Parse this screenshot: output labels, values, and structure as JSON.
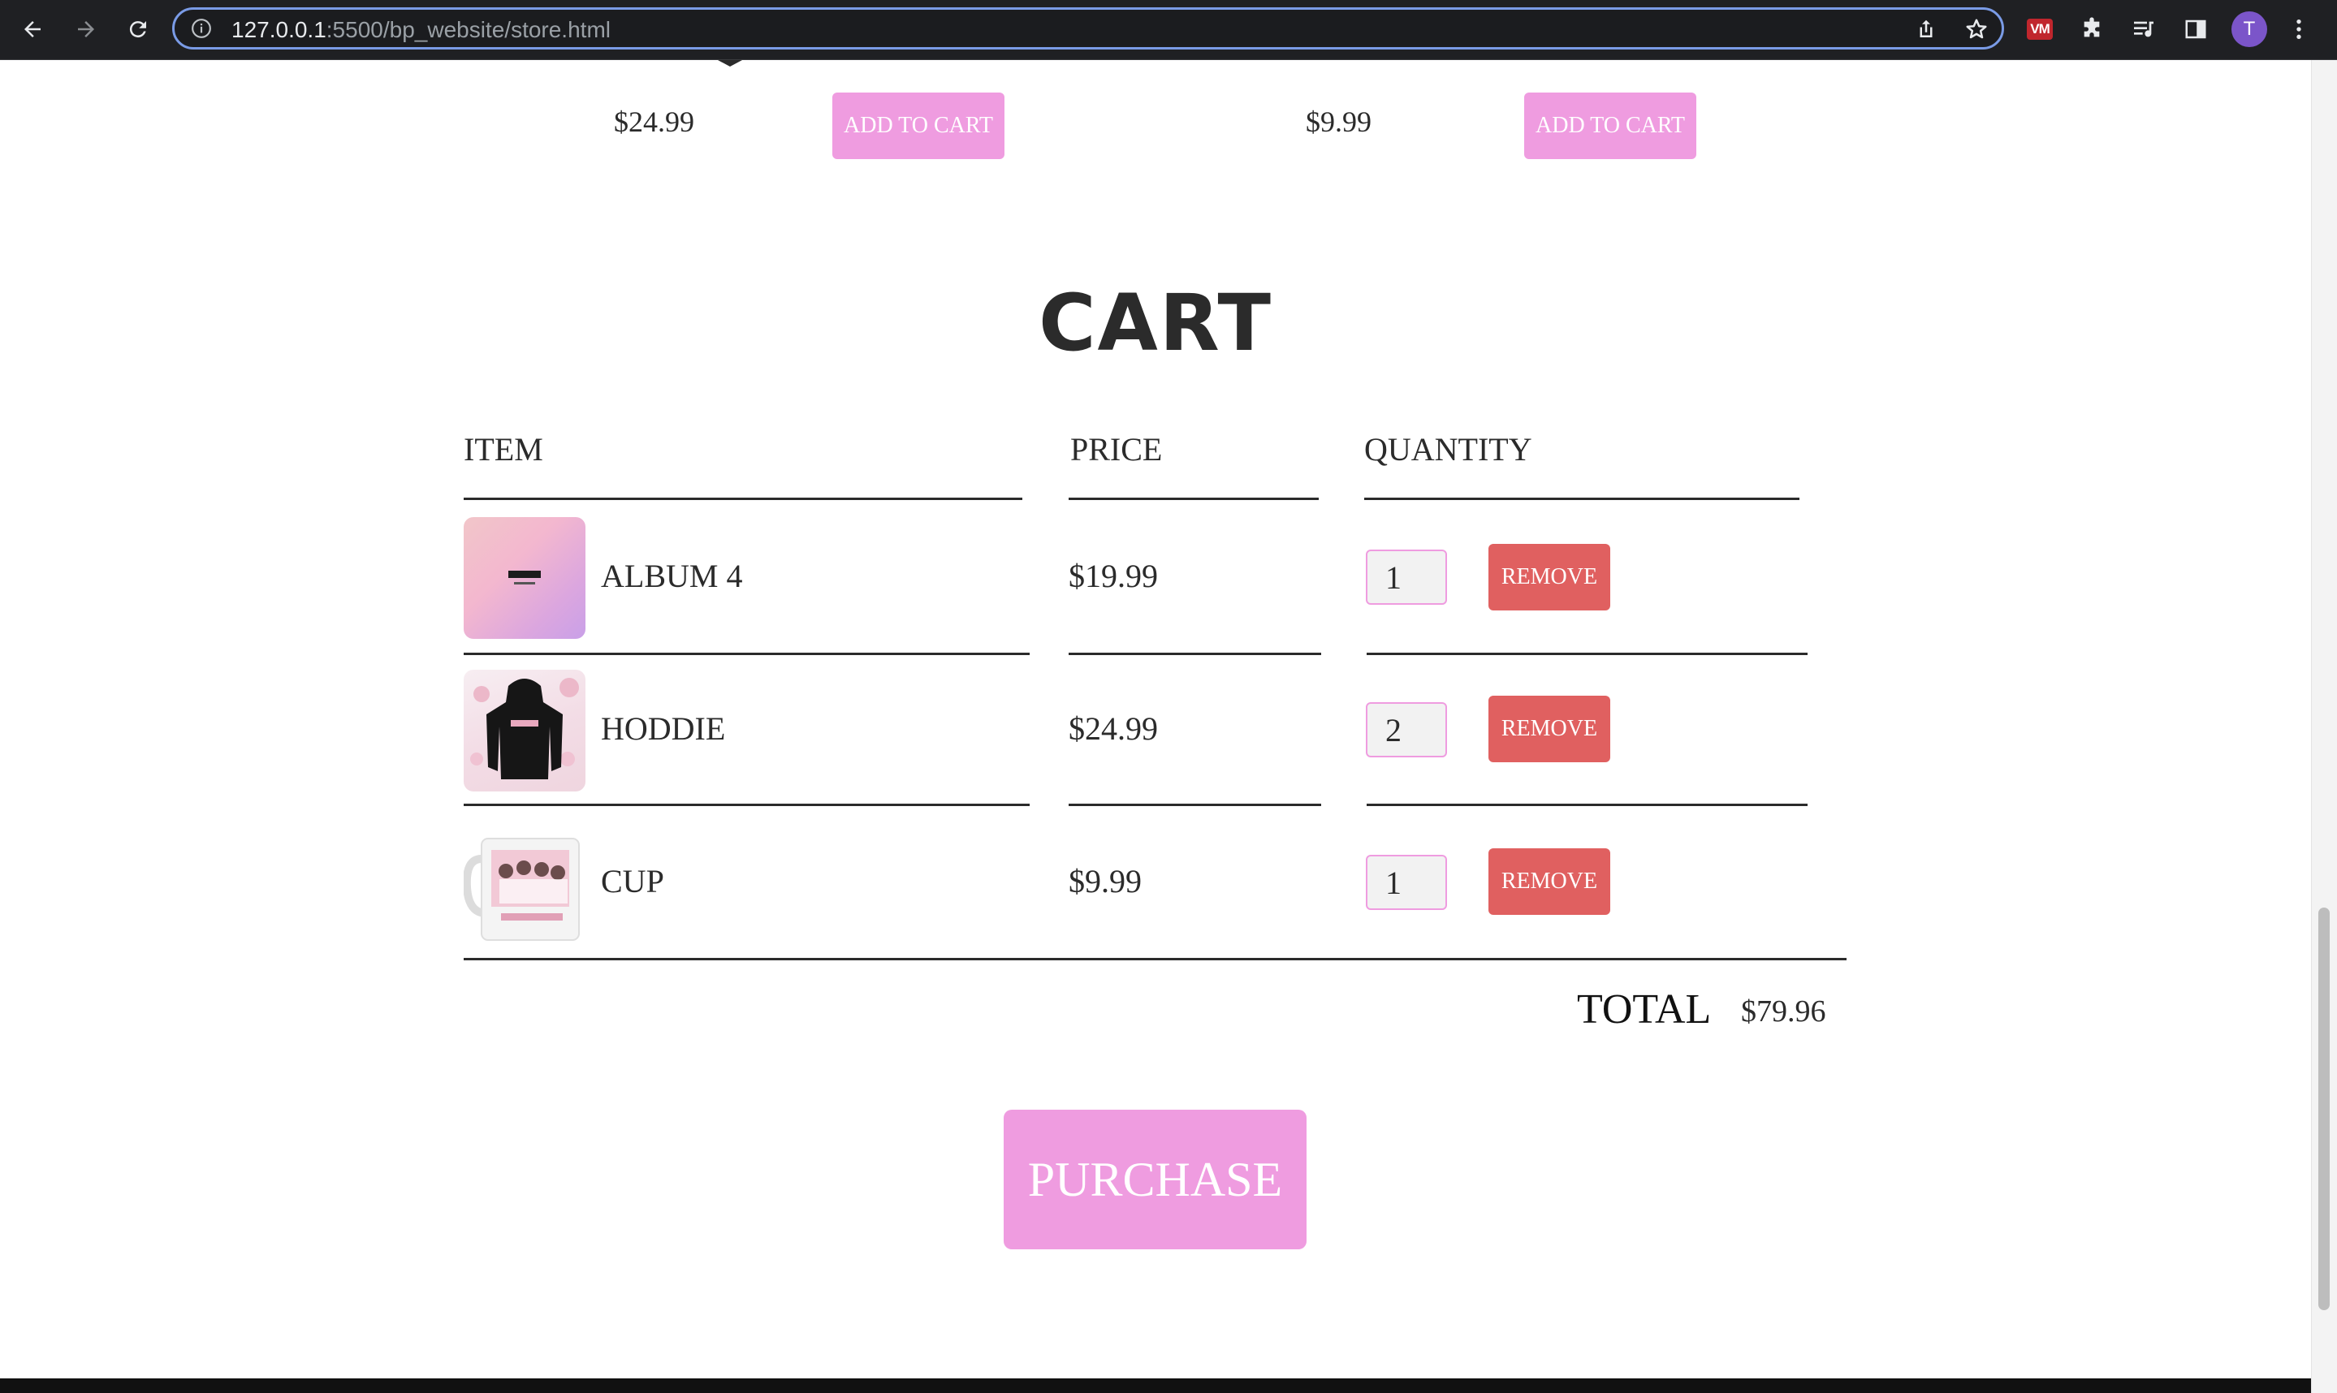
{
  "browser": {
    "url_host": "127.0.0.1",
    "url_path": ":5500/bp_website/store.html",
    "profile_initial": "T",
    "extension_badge": "VM"
  },
  "store": {
    "products": [
      {
        "price": "$24.99",
        "button": "ADD TO CART"
      },
      {
        "price": "$9.99",
        "button": "ADD TO CART"
      }
    ]
  },
  "cart": {
    "title": "CART",
    "columns": {
      "item": "ITEM",
      "price": "PRICE",
      "quantity": "QUANTITY"
    },
    "items": [
      {
        "name": "ALBUM 4",
        "price": "$19.99",
        "quantity": "1",
        "remove_label": "REMOVE",
        "image": "album-cover"
      },
      {
        "name": "HODDIE",
        "price": "$24.99",
        "quantity": "2",
        "remove_label": "REMOVE",
        "image": "hoodie"
      },
      {
        "name": "CUP",
        "price": "$9.99",
        "quantity": "1",
        "remove_label": "REMOVE",
        "image": "mug"
      }
    ],
    "total_label": "TOTAL",
    "total_value": "$79.96",
    "purchase_label": "PURCHASE"
  },
  "colors": {
    "accent_pink": "#ef9ce0",
    "remove_red": "#e06060",
    "text": "#2b2b2b"
  }
}
